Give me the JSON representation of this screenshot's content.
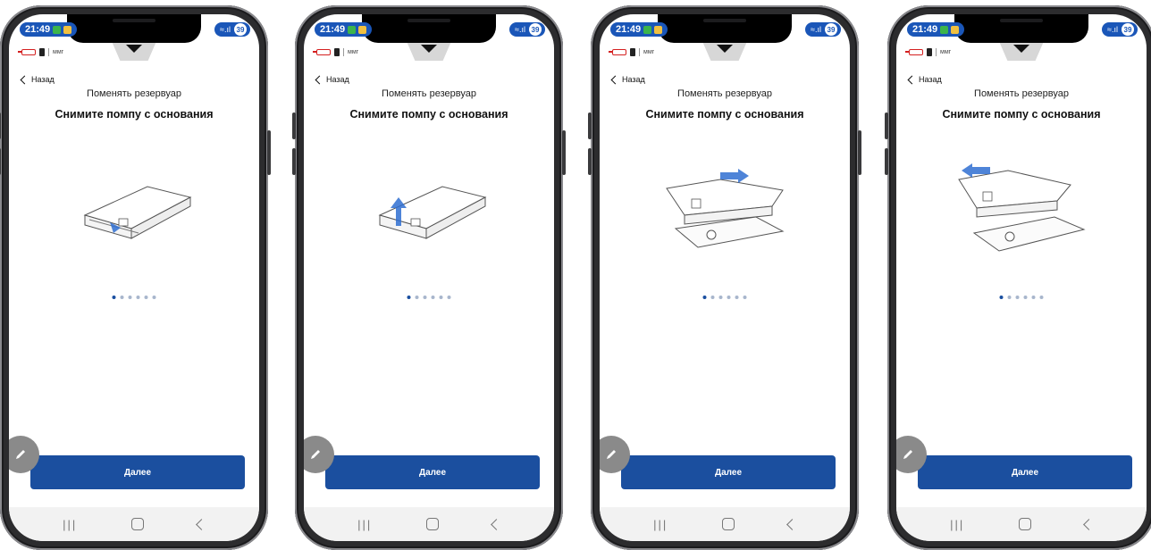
{
  "status_bar": {
    "time": "21:49",
    "battery": "39"
  },
  "pump_status": {
    "unit": "ммг"
  },
  "header": {
    "back_label": "Назад",
    "subtitle": "Поменять резервуар"
  },
  "screens": [
    {
      "title": "Снимите помпу с основания",
      "step": "push-release",
      "active_dot": 0
    },
    {
      "title": "Снимите помпу с основания",
      "step": "lift-up",
      "active_dot": 0
    },
    {
      "title": "Снимите помпу с основания",
      "step": "slide-off",
      "active_dot": 0
    },
    {
      "title": "Снимите помпу с основания",
      "step": "separated",
      "active_dot": 0
    }
  ],
  "pagination": {
    "total": 6
  },
  "buttons": {
    "next_label": "Далее"
  },
  "colors": {
    "accent": "#1b4f9f",
    "status_bar": "#1a56b8",
    "alert": "#d42020"
  },
  "icons": {
    "back": "chevron-left-icon",
    "edit": "pencil-icon",
    "nav": [
      "recent-apps-icon",
      "home-icon",
      "back-icon"
    ]
  }
}
